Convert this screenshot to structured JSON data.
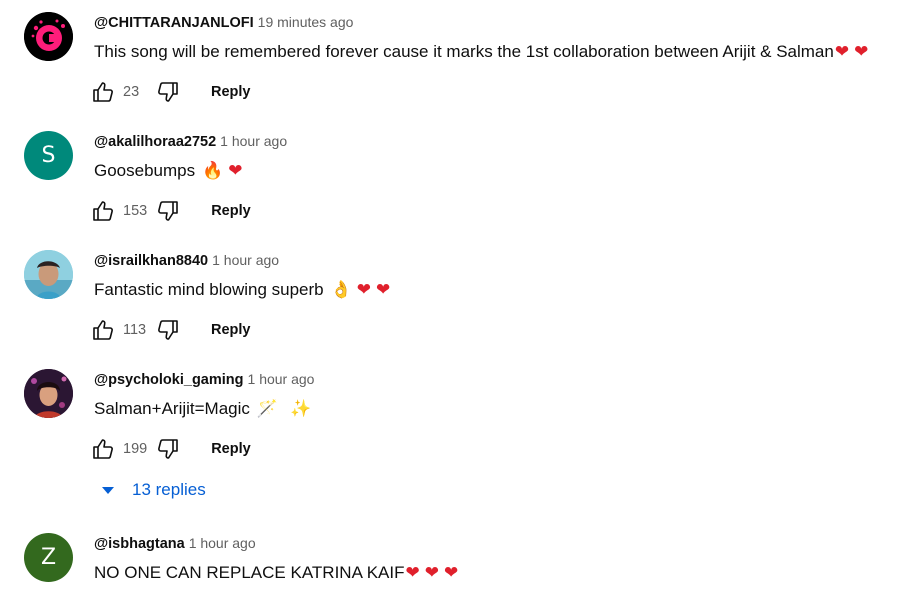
{
  "comments": [
    {
      "author": "@CHITTARANJANLOFI",
      "time": "19 minutes ago",
      "text": "This song will be remembered forever cause it marks the 1st collaboration between Arijit & Salman",
      "emojis": [
        "❤",
        "❤"
      ],
      "likes": "23",
      "reply_label": "Reply",
      "avatar": {
        "type": "logo",
        "letter": "c",
        "bg": "#000000",
        "accent": "#ff1d7a"
      }
    },
    {
      "author": "@akalilhoraa2752",
      "time": "1 hour ago",
      "text": "Goosebumps",
      "emojis": [
        "🔥",
        "❤"
      ],
      "likes": "153",
      "reply_label": "Reply",
      "avatar": {
        "type": "letter",
        "letter": "S",
        "bg": "#00897b"
      }
    },
    {
      "author": "@israilkhan8840",
      "time": "1 hour ago",
      "text": "Fantastic mind blowing superb",
      "emojis": [
        "👌",
        "❤",
        "❤"
      ],
      "likes": "113",
      "reply_label": "Reply",
      "avatar": {
        "type": "photo",
        "bg": "#7fc6d8"
      }
    },
    {
      "author": "@psycholoki_gaming",
      "time": "1 hour ago",
      "text": "Salman+Arijit=Magic",
      "emojis": [
        "🪄",
        "✨"
      ],
      "likes": "199",
      "reply_label": "Reply",
      "avatar": {
        "type": "photo",
        "bg": "#3a1f3f"
      }
    },
    {
      "author": "@isbhagtana",
      "time": "1 hour ago",
      "text": "NO ONE CAN REPLACE KATRINA KAIF",
      "emojis": [
        "❤",
        "❤",
        "❤"
      ],
      "avatar": {
        "type": "letter",
        "letter": "Z",
        "bg": "#33691e"
      }
    }
  ],
  "replies_toggle": {
    "label": "13 replies",
    "color": "#065fd4"
  },
  "icons": {
    "like": "thumbs-up-icon",
    "dislike": "thumbs-down-icon",
    "replies": "caret-down-icon"
  }
}
